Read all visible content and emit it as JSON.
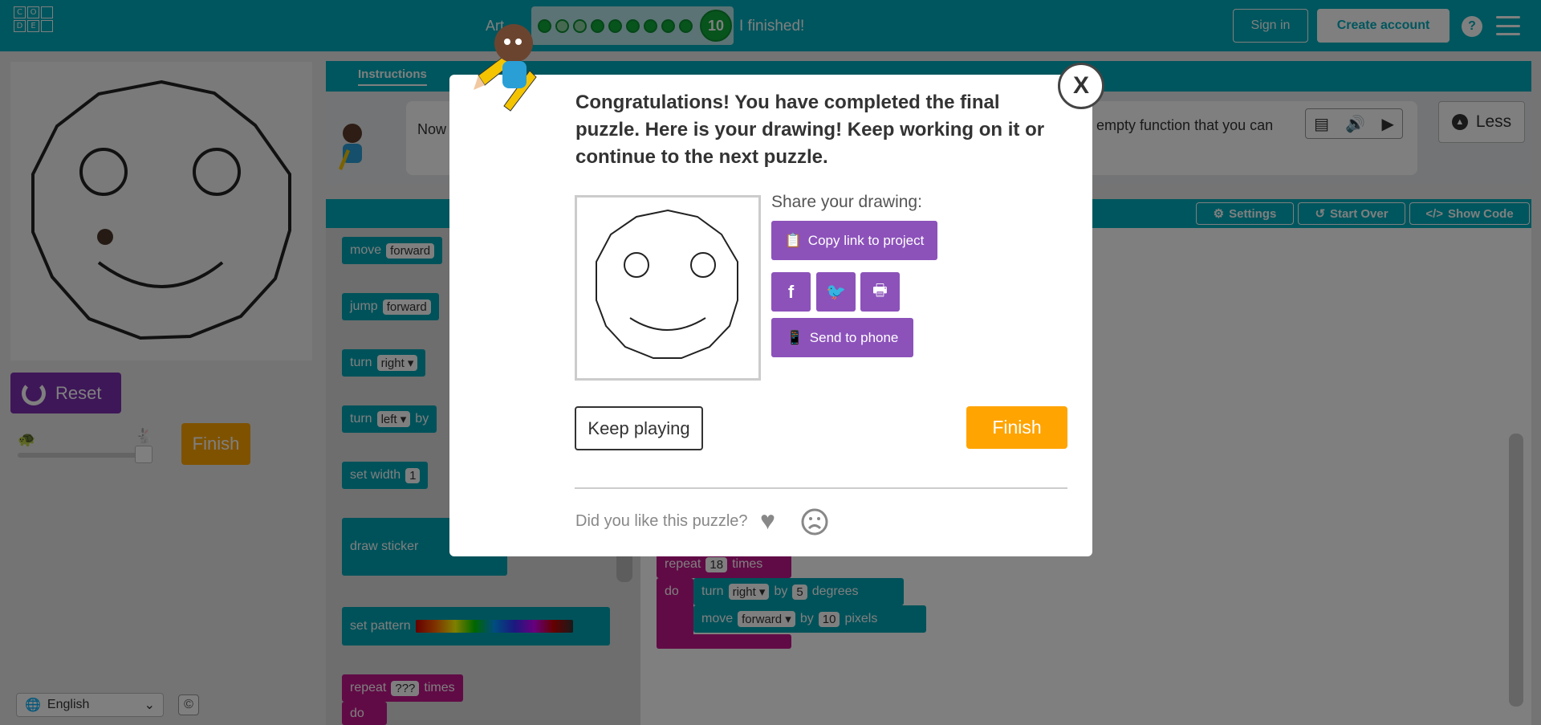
{
  "header": {
    "logo_letters": [
      "C",
      "O",
      "",
      "D",
      "E",
      ""
    ],
    "level_label": "Art",
    "progress_dots": 9,
    "progress_empty": [
      1,
      2
    ],
    "current_level": "10",
    "finished_text": "I finished!",
    "sign_in": "Sign in",
    "create_account": "Create account",
    "help": "?"
  },
  "left": {
    "reset": "Reset",
    "finish": "Finish",
    "language": "English",
    "copyright": "©"
  },
  "instructions": {
    "tab": "Instructions",
    "text_left": "Now ... make ...",
    "text_right": "empty function that you can",
    "less": "Less"
  },
  "workspace": {
    "settings": "Settings",
    "start_over": "Start Over",
    "show_code": "Show Code"
  },
  "toolbox_blocks": [
    {
      "label": "move",
      "slot": "forward"
    },
    {
      "label": "jump",
      "slot": "forward"
    },
    {
      "label": "turn",
      "slot": "right ▾"
    },
    {
      "label": "turn",
      "slot": "left ▾",
      "suffix": "by"
    },
    {
      "label": "set width",
      "slot": "1"
    },
    {
      "label": "draw sticker",
      "slot": ""
    },
    {
      "label": "set pattern",
      "slot": ""
    },
    {
      "label": "repeat",
      "slot": "???",
      "suffix": "times"
    },
    {
      "label": "do",
      "slot": ""
    }
  ],
  "workspace_blocks": {
    "repeat_label": "repeat",
    "repeat_count": "18",
    "repeat_times": "times",
    "do_label": "do",
    "turn_label": "turn",
    "turn_dir": "right ▾",
    "turn_by": "by",
    "turn_deg": "5",
    "turn_unit": "degrees",
    "move_label": "move",
    "move_dir": "forward ▾",
    "move_by": "by",
    "move_px": "10",
    "move_unit": "pixels"
  },
  "modal": {
    "title": "Congratulations! You have completed the final puzzle. Here is your drawing! Keep working on it or continue to the next puzzle.",
    "close": "X",
    "share_label": "Share your drawing:",
    "copy_link": "Copy link to project",
    "send_to_phone": "Send to phone",
    "keep_playing": "Keep playing",
    "finish": "Finish",
    "like_prompt": "Did you like this puzzle?",
    "social_icons": [
      "facebook-icon",
      "twitter-icon",
      "print-icon"
    ]
  },
  "colors": {
    "teal": "#00adbc",
    "purple": "#8c52ba",
    "orange": "#ffa400",
    "green": "#0ea83a"
  }
}
